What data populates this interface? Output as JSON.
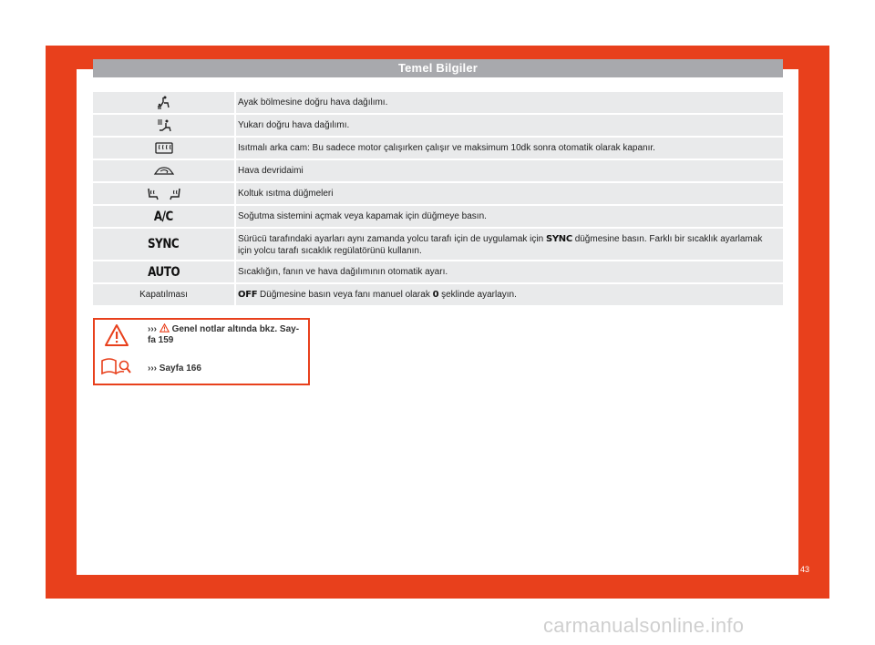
{
  "header": {
    "title": "Temel Bilgiler"
  },
  "rows": [
    {
      "icon": "air-to-footwell-icon",
      "text": "Ayak bölmesine doğru hava dağılımı."
    },
    {
      "icon": "air-upward-icon",
      "text": "Yukarı doğru hava dağılımı."
    },
    {
      "icon": "rear-defrost-icon",
      "text": "Isıtmalı arka cam: Bu sadece motor çalışırken çalışır ve maksimum 10dk sonra otomatik olarak kapanır."
    },
    {
      "icon": "air-recirculation-icon",
      "text": "Hava devridaimi"
    },
    {
      "icon": "seat-heating-icon",
      "text": "Koltuk ısıtma düğmeleri"
    },
    {
      "label": "A/C",
      "text": "Soğutma sistemini açmak veya kapamak için düğmeye basın."
    },
    {
      "label": "SYNC",
      "text_before": "Sürücü tarafındaki ayarları aynı zamanda yolcu tarafı için de uygulamak için",
      "inline_label": "SYNC",
      "text_after": "düğmesine basın. Farklı bir sıcaklık ayarlamak için yolcu tarafı sıcaklık regülatörünü kullanın."
    },
    {
      "label": "AUTO",
      "text": "Sıcaklığın, fanın ve hava dağılımının otomatik ayarı."
    },
    {
      "label": "Kapatılması",
      "inline_label": "OFF",
      "text_before": "Düğmesine basın veya fanı manuel olarak",
      "inline_label2": "0",
      "text_after": "şeklinde ayarlayın."
    }
  ],
  "note": {
    "arrows_1": "›››",
    "line1": "Genel notlar altında bkz. Say-",
    "line1b": "fa 159",
    "arrows_2": "›››",
    "line2": "Sayfa 166"
  },
  "page_number": "43",
  "watermark": "carmanualsonline.info",
  "colors": {
    "frame": "#e8401c",
    "header": "#a8a9ad",
    "row": "#e9eaeb"
  }
}
